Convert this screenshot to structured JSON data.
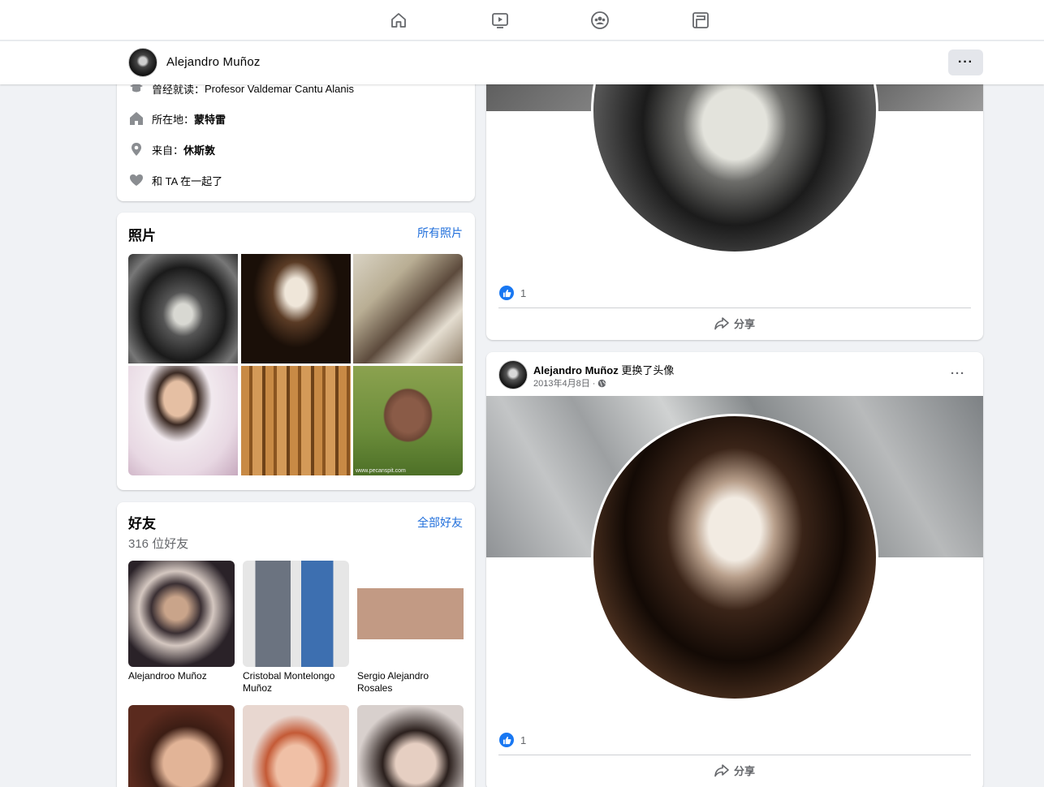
{
  "nav": {
    "icons": [
      "home-icon",
      "watch-icon",
      "groups-icon",
      "gaming-icon"
    ]
  },
  "profile_bar": {
    "name": "Alejandro Muñoz",
    "more_label": "···"
  },
  "intro": {
    "studied_label": "曾经就读：",
    "studied_value": "Profesor Valdemar Cantu Alanis",
    "lives_label": "所在地：",
    "lives_value": "蒙特雷",
    "from_label": "来自：",
    "from_value": "休斯敦",
    "relationship": "和 TA 在一起了"
  },
  "photos": {
    "title": "照片",
    "link": "所有照片",
    "watermark": "www.pecanspit.com"
  },
  "friends": {
    "title": "好友",
    "link": "全部好友",
    "count": "316 位好友",
    "items": [
      {
        "name": "Alejandroo Muñoz"
      },
      {
        "name": "Cristobal Montelongo Muñoz"
      },
      {
        "name": "Sergio Alejandro Rosales"
      },
      {
        "name": ""
      },
      {
        "name": ""
      },
      {
        "name": ""
      }
    ]
  },
  "post1": {
    "like_count": "1",
    "share_label": "分享"
  },
  "post2": {
    "author": "Alejandro Muñoz",
    "action": "更换了头像",
    "date": "2013年4月8日 ·",
    "more_label": "···",
    "like_count": "1",
    "share_label": "分享"
  },
  "colors": {
    "link": "#216fdb",
    "like": "#1877f2",
    "background": "#f0f2f5"
  }
}
